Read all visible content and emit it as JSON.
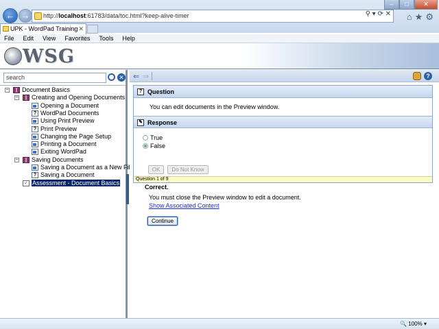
{
  "browser": {
    "address_prefix": "http://",
    "address_host": "localhost",
    "address_rest": ":61783/data/toc.html?keep-alive-timer",
    "tab_title": "UPK - WordPad Training",
    "menu": [
      "File",
      "Edit",
      "View",
      "Favorites",
      "Tools",
      "Help"
    ],
    "zoom": "100%"
  },
  "header": {
    "logo_text": "WSG"
  },
  "sidebar": {
    "search_placeholder": "search",
    "tree": [
      {
        "label": "Document Basics",
        "level": 0,
        "icon": "book-icon",
        "expanded": true
      },
      {
        "label": "Creating and Opening Documents",
        "level": 1,
        "icon": "book-icon",
        "expanded": true
      },
      {
        "label": "Opening a Document",
        "level": 2,
        "icon": "topic-icon"
      },
      {
        "label": "WordPad Documents",
        "level": 2,
        "icon": "question-page-icon"
      },
      {
        "label": "Using Print Preview",
        "level": 2,
        "icon": "topic-icon"
      },
      {
        "label": "Print Preview",
        "level": 2,
        "icon": "question-page-icon"
      },
      {
        "label": "Changing the Page Setup",
        "level": 2,
        "icon": "topic-icon"
      },
      {
        "label": "Printing a Document",
        "level": 2,
        "icon": "topic-icon"
      },
      {
        "label": "Exiting WordPad",
        "level": 2,
        "icon": "topic-icon"
      },
      {
        "label": "Saving Documents",
        "level": 1,
        "icon": "book-icon",
        "expanded": true
      },
      {
        "label": "Saving a Document as a New File",
        "level": 2,
        "icon": "topic-icon"
      },
      {
        "label": "Saving a Document",
        "level": 2,
        "icon": "question-page-icon"
      },
      {
        "label": "Assessment - Document Basics",
        "level": 1,
        "icon": "assessment-icon",
        "selected": true
      }
    ]
  },
  "question": {
    "heading": "Question",
    "text": "You can edit documents in the Preview window."
  },
  "response": {
    "heading": "Response",
    "options": [
      {
        "label": "True",
        "selected": false
      },
      {
        "label": "False",
        "selected": true
      }
    ],
    "ok_label": "OK",
    "do_not_know_label": "Do Not Know",
    "progress": "Question 1 of 9"
  },
  "feedback": {
    "title": "Correct.",
    "message": "You must close the Preview window to edit a document.",
    "link": "Show Associated Content",
    "continue_label": "Continue"
  }
}
